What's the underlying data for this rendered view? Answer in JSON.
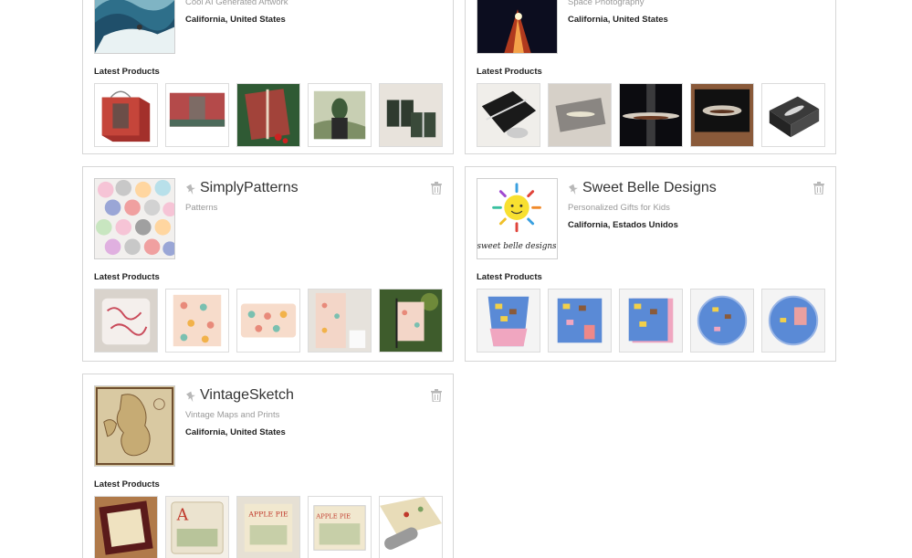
{
  "stores": [
    {
      "name": "",
      "tagline": "Cool AI Generated Artwork",
      "location": "California, United States",
      "latest_label": "Latest Products"
    },
    {
      "name": "",
      "tagline": "Space Photography",
      "location": "California, United States",
      "latest_label": "Latest Products"
    },
    {
      "name": "SimplyPatterns",
      "tagline": "Patterns",
      "location": "",
      "latest_label": "Latest Products"
    },
    {
      "name": "Sweet Belle Designs",
      "tagline": "Personalized Gifts for Kids",
      "location": "California, Estados Unidos",
      "latest_label": "Latest Products"
    },
    {
      "name": "VintageSketch",
      "tagline": "Vintage Maps and Prints",
      "location": "California, United States",
      "latest_label": "Latest Products"
    }
  ],
  "icons": {
    "pin": "pin-icon",
    "trash": "trash-icon"
  },
  "colors": {
    "border": "#d6d6d6",
    "muted_text": "#999999",
    "icon": "#b8b8b8"
  },
  "logo_texts": {
    "sweet_belle": "sweet belle designs"
  },
  "product_texts": {
    "apple_pie_letter": "A",
    "apple_pie_title": "APPLE PIE"
  }
}
